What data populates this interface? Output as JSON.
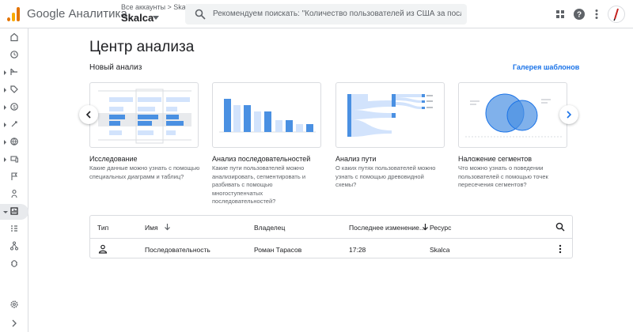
{
  "header": {
    "app_name": "Google Аналитика",
    "breadcrumb": "Все аккаунты > Skalca",
    "account": "Skalca",
    "search_placeholder": "Рекомендуем поискать: \"Количество пользователей из США за после..."
  },
  "colors": {
    "accent": "#1a73e8",
    "logo_orange": "#e37400",
    "logo_yellow": "#f9ab00",
    "thumb_blue": "#4a90e2"
  },
  "rail": {
    "items": [
      {
        "icon": "home-icon"
      },
      {
        "icon": "realtime-clock-icon"
      },
      {
        "icon": "lifecycle-icon"
      },
      {
        "icon": "tag-icon"
      },
      {
        "icon": "monetization-icon"
      },
      {
        "icon": "retention-icon"
      },
      {
        "icon": "globe-icon"
      },
      {
        "icon": "devices-icon"
      },
      {
        "icon": "flag-icon"
      },
      {
        "icon": "user-touch-icon"
      },
      {
        "icon": "explore-icon"
      },
      {
        "icon": "segments-icon"
      },
      {
        "icon": "tree-icon"
      },
      {
        "icon": "debug-icon"
      },
      {
        "icon": "settings-icon"
      },
      {
        "icon": "expand-chevron-icon"
      }
    ]
  },
  "main": {
    "title": "Центр анализа",
    "new_analysis_label": "Новый анализ",
    "gallery_link": "Галерея шаблонов",
    "templates": [
      {
        "title": "Исследование",
        "description": "Какие данные можно узнать с помощью специальных диаграмм и таблиц?"
      },
      {
        "title": "Анализ последовательностей",
        "description": "Какие пути пользователей можно анализировать, сегментировать и разбивать с помощью многоступенчатых последовательностей?"
      },
      {
        "title": "Анализ пути",
        "description": "О каких путях пользователей можно узнать с помощью древовидной схемы?"
      },
      {
        "title": "Наложение сегментов",
        "description": "Что можно узнать о поведении пользователей с помощью точек пересечения сегментов?"
      }
    ],
    "table": {
      "headers": {
        "type": "Тип",
        "name": "Имя",
        "owner": "Владелец",
        "modified": "Последнее изменение...",
        "resource": "Ресурс"
      },
      "rows": [
        {
          "type_icon": "person-icon",
          "name": "Последовательность",
          "owner": "Роман Тарасов",
          "modified": "17:28",
          "resource": "Skalca"
        }
      ]
    }
  }
}
